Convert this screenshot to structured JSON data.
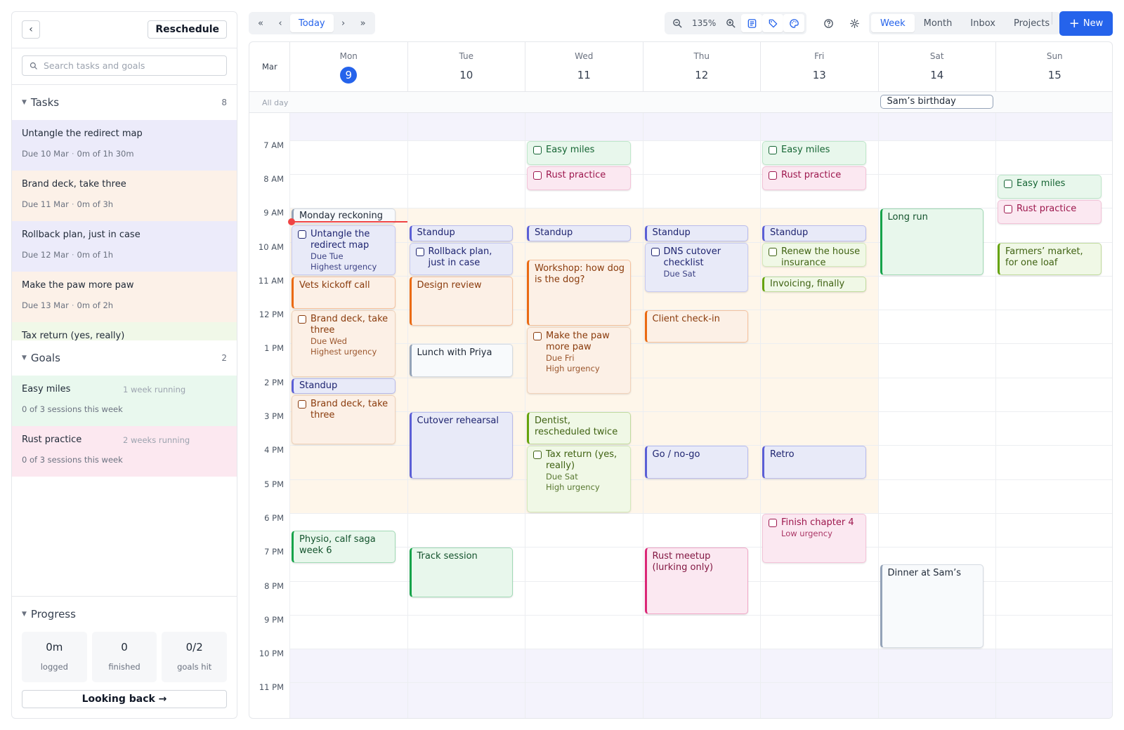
{
  "sidebar": {
    "reschedule_label": "Reschedule",
    "search_placeholder": "Search tasks and goals",
    "tasks_title": "Tasks",
    "tasks_count": "8",
    "tasks": [
      {
        "name": "Untangle the redirect map",
        "due": "Due 10 Mar",
        "time": "0m of 1h 30m",
        "color": "#ecebfa"
      },
      {
        "name": "Brand deck, take three",
        "due": "Due 11 Mar",
        "time": "0m of 3h",
        "color": "#fcf1e8"
      },
      {
        "name": "Rollback plan, just in case",
        "due": "Due 12 Mar",
        "time": "0m of 1h",
        "color": "#ecebfa"
      },
      {
        "name": "Make the paw more paw",
        "due": "Due 13 Mar",
        "time": "0m of 2h",
        "color": "#fcf1e8"
      },
      {
        "name": "Tax return (yes, really)",
        "due": "",
        "time": "",
        "color": "#f0f8e8"
      }
    ],
    "goals_title": "Goals",
    "goals_count": "2",
    "goals": [
      {
        "name": "Easy miles",
        "running": "1 week running",
        "sessions": "0 of 3 sessions this week",
        "color": "#e9f8ee"
      },
      {
        "name": "Rust practice",
        "running": "2 weeks running",
        "sessions": "0 of 3 sessions this week",
        "color": "#fce8f0"
      }
    ],
    "progress_title": "Progress",
    "stats": [
      {
        "value": "0m",
        "label": "logged"
      },
      {
        "value": "0",
        "label": "finished"
      },
      {
        "value": "0/2",
        "label": "goals hit"
      }
    ],
    "looking_back_label": "Looking back →"
  },
  "toolbar": {
    "nav": {
      "first": "«",
      "prev": "‹",
      "today": "Today",
      "next": "›",
      "last": "»"
    },
    "zoom": "135%",
    "views": [
      "Week",
      "Month",
      "Inbox",
      "Projects"
    ],
    "active_view": "Week",
    "new_label": "New"
  },
  "calendar": {
    "month": "Mar",
    "allday_label": "All day",
    "days": [
      {
        "dow": "Mon",
        "num": "9",
        "today": true
      },
      {
        "dow": "Tue",
        "num": "10"
      },
      {
        "dow": "Wed",
        "num": "11"
      },
      {
        "dow": "Thu",
        "num": "12"
      },
      {
        "dow": "Fri",
        "num": "13"
      },
      {
        "dow": "Sat",
        "num": "14"
      },
      {
        "dow": "Sun",
        "num": "15"
      }
    ],
    "allday_events": [
      {
        "day": 5,
        "title": "Sam’s birthday"
      }
    ],
    "hours": [
      "7 AM",
      "8 AM",
      "9 AM",
      "10 AM",
      "11 AM",
      "12 PM",
      "1 PM",
      "2 PM",
      "3 PM",
      "4 PM",
      "5 PM",
      "6 PM",
      "7 PM",
      "8 PM",
      "9 PM",
      "10 PM",
      "11 PM"
    ],
    "now_time": 9.4,
    "events": [
      {
        "day": 0,
        "start": 9.0,
        "end": 9.5,
        "title": "Monday reckoning",
        "kind": "plain"
      },
      {
        "day": 0,
        "start": 9.5,
        "end": 11.0,
        "title": "Untangle the redirect map",
        "kind": "task-blue",
        "task": true,
        "sub": [
          "Due Tue",
          "Highest urgency"
        ]
      },
      {
        "day": 0,
        "start": 11.0,
        "end": 12.0,
        "title": "Vets kickoff call",
        "kind": "orange"
      },
      {
        "day": 0,
        "start": 12.0,
        "end": 14.0,
        "title": "Brand deck, take three",
        "kind": "task-orange",
        "task": true,
        "sub": [
          "Due Wed",
          "Highest urgency"
        ]
      },
      {
        "day": 0,
        "start": 14.0,
        "end": 14.5,
        "title": "Standup",
        "kind": "blue"
      },
      {
        "day": 0,
        "start": 14.5,
        "end": 16.0,
        "title": "Brand deck, take three",
        "kind": "task-orange",
        "task": true
      },
      {
        "day": 0,
        "start": 18.5,
        "end": 19.5,
        "title": "Physio, calf saga week 6",
        "kind": "green"
      },
      {
        "day": 1,
        "start": 9.5,
        "end": 10.0,
        "title": "Standup",
        "kind": "blue"
      },
      {
        "day": 1,
        "start": 10.0,
        "end": 11.0,
        "title": "Rollback plan, just in case",
        "kind": "task-blue",
        "task": true
      },
      {
        "day": 1,
        "start": 11.0,
        "end": 12.5,
        "title": "Design review",
        "kind": "orange"
      },
      {
        "day": 1,
        "start": 13.0,
        "end": 14.0,
        "title": "Lunch with Priya",
        "kind": "plain"
      },
      {
        "day": 1,
        "start": 15.0,
        "end": 17.0,
        "title": "Cutover rehearsal",
        "kind": "blue"
      },
      {
        "day": 1,
        "start": 19.0,
        "end": 20.5,
        "title": "Track session",
        "kind": "green"
      },
      {
        "day": 2,
        "start": 7.0,
        "end": 7.75,
        "title": "Easy miles",
        "kind": "task-green",
        "task": true
      },
      {
        "day": 2,
        "start": 7.75,
        "end": 8.5,
        "title": "Rust practice",
        "kind": "task-pink",
        "task": true
      },
      {
        "day": 2,
        "start": 9.5,
        "end": 10.0,
        "title": "Standup",
        "kind": "blue"
      },
      {
        "day": 2,
        "start": 10.5,
        "end": 12.5,
        "title": "Workshop: how dog is the dog?",
        "kind": "orange"
      },
      {
        "day": 2,
        "start": 12.5,
        "end": 14.5,
        "title": "Make the paw more paw",
        "kind": "task-orange",
        "task": true,
        "sub": [
          "Due Fri",
          "High urgency"
        ]
      },
      {
        "day": 2,
        "start": 15.0,
        "end": 16.0,
        "title": "Dentist, rescheduled twice",
        "kind": "lime"
      },
      {
        "day": 2,
        "start": 16.0,
        "end": 18.0,
        "title": "Tax return (yes, really)",
        "kind": "task-lime",
        "task": true,
        "sub": [
          "Due Sat",
          "High urgency"
        ]
      },
      {
        "day": 3,
        "start": 9.5,
        "end": 10.0,
        "title": "Standup",
        "kind": "blue"
      },
      {
        "day": 3,
        "start": 10.0,
        "end": 11.5,
        "title": "DNS cutover checklist",
        "kind": "task-blue",
        "task": true,
        "sub": [
          "Due Sat"
        ]
      },
      {
        "day": 3,
        "start": 12.0,
        "end": 13.0,
        "title": "Client check-in",
        "kind": "orange"
      },
      {
        "day": 3,
        "start": 16.0,
        "end": 17.0,
        "title": "Go / no-go",
        "kind": "blue"
      },
      {
        "day": 3,
        "start": 19.0,
        "end": 21.0,
        "title": "Rust meetup (lurking only)",
        "kind": "pink"
      },
      {
        "day": 4,
        "start": 7.0,
        "end": 7.75,
        "title": "Easy miles",
        "kind": "task-green",
        "task": true
      },
      {
        "day": 4,
        "start": 7.75,
        "end": 8.5,
        "title": "Rust practice",
        "kind": "task-pink",
        "task": true
      },
      {
        "day": 4,
        "start": 9.5,
        "end": 10.0,
        "title": "Standup",
        "kind": "blue"
      },
      {
        "day": 4,
        "start": 10.0,
        "end": 10.75,
        "title": "Renew the house insurance",
        "kind": "task-lime",
        "task": true
      },
      {
        "day": 4,
        "start": 11.0,
        "end": 11.5,
        "title": "Invoicing, finally",
        "kind": "lime"
      },
      {
        "day": 4,
        "start": 16.0,
        "end": 17.0,
        "title": "Retro",
        "kind": "blue"
      },
      {
        "day": 4,
        "start": 18.0,
        "end": 19.5,
        "title": "Finish chapter 4",
        "kind": "task-pink",
        "task": true,
        "sub": [
          "Low urgency"
        ]
      },
      {
        "day": 5,
        "start": 9.0,
        "end": 11.0,
        "title": "Long run",
        "kind": "green"
      },
      {
        "day": 5,
        "start": 19.5,
        "end": 22.0,
        "title": "Dinner at Sam’s",
        "kind": "plain"
      },
      {
        "day": 6,
        "start": 8.0,
        "end": 8.75,
        "title": "Easy miles",
        "kind": "task-green",
        "task": true
      },
      {
        "day": 6,
        "start": 8.75,
        "end": 9.5,
        "title": "Rust practice",
        "kind": "task-pink",
        "task": true
      },
      {
        "day": 6,
        "start": 10.0,
        "end": 11.0,
        "title": "Farmers’ market, for one loaf",
        "kind": "lime"
      }
    ]
  },
  "colors": {
    "accent": "#2563eb",
    "now": "#ef4444",
    "work_hours": "#fef6ea",
    "off_hours": "#f4f3fc"
  }
}
